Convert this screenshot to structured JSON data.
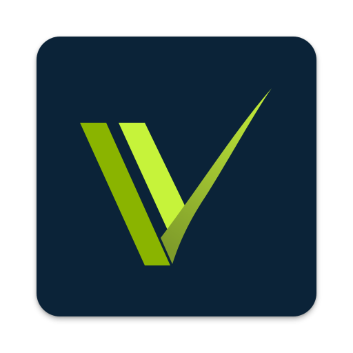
{
  "app_icon": {
    "background_color": "#0b2338",
    "icon_name": "v-checkmark-logo-icon"
  },
  "logo": {
    "left_stroke_color": "#8ab400",
    "inner_stroke_color": "#c6f33a",
    "swoosh_start_color": "#7e9b2a",
    "swoosh_end_color": "#c6ef3a"
  }
}
